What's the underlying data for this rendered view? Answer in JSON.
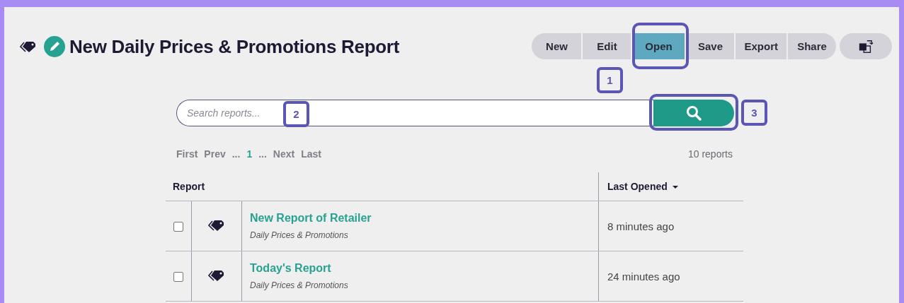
{
  "title": "New Daily Prices & Promotions Report",
  "toolbar": [
    {
      "label": "New",
      "selected": false
    },
    {
      "label": "Edit",
      "selected": false
    },
    {
      "label": "Open",
      "selected": true
    },
    {
      "label": "Save",
      "selected": false
    },
    {
      "label": "Export",
      "selected": false
    },
    {
      "label": "Share",
      "selected": false
    }
  ],
  "search": {
    "placeholder": "Search reports..."
  },
  "pagination": [
    {
      "label": "First",
      "selected": false
    },
    {
      "label": "Prev",
      "selected": false
    },
    {
      "label": "...",
      "selected": false
    },
    {
      "label": "1",
      "selected": true
    },
    {
      "label": "...",
      "selected": false
    },
    {
      "label": "Next",
      "selected": false
    },
    {
      "label": "Last",
      "selected": false
    }
  ],
  "report_count": "10 reports",
  "table": {
    "columns": [
      {
        "label": "Report",
        "sorted": false
      },
      {
        "label": "Last Opened",
        "sorted": true
      }
    ],
    "rows": [
      {
        "checked": false,
        "name": "New Report of Retailer",
        "type": "Daily Prices & Promotions",
        "last_opened": "8 minutes ago"
      },
      {
        "checked": false,
        "name": "Today's Report",
        "type": "Daily Prices & Promotions",
        "last_opened": "24 minutes ago"
      }
    ]
  },
  "callouts": [
    {
      "label": "1"
    },
    {
      "label": "2"
    },
    {
      "label": "3"
    }
  ]
}
